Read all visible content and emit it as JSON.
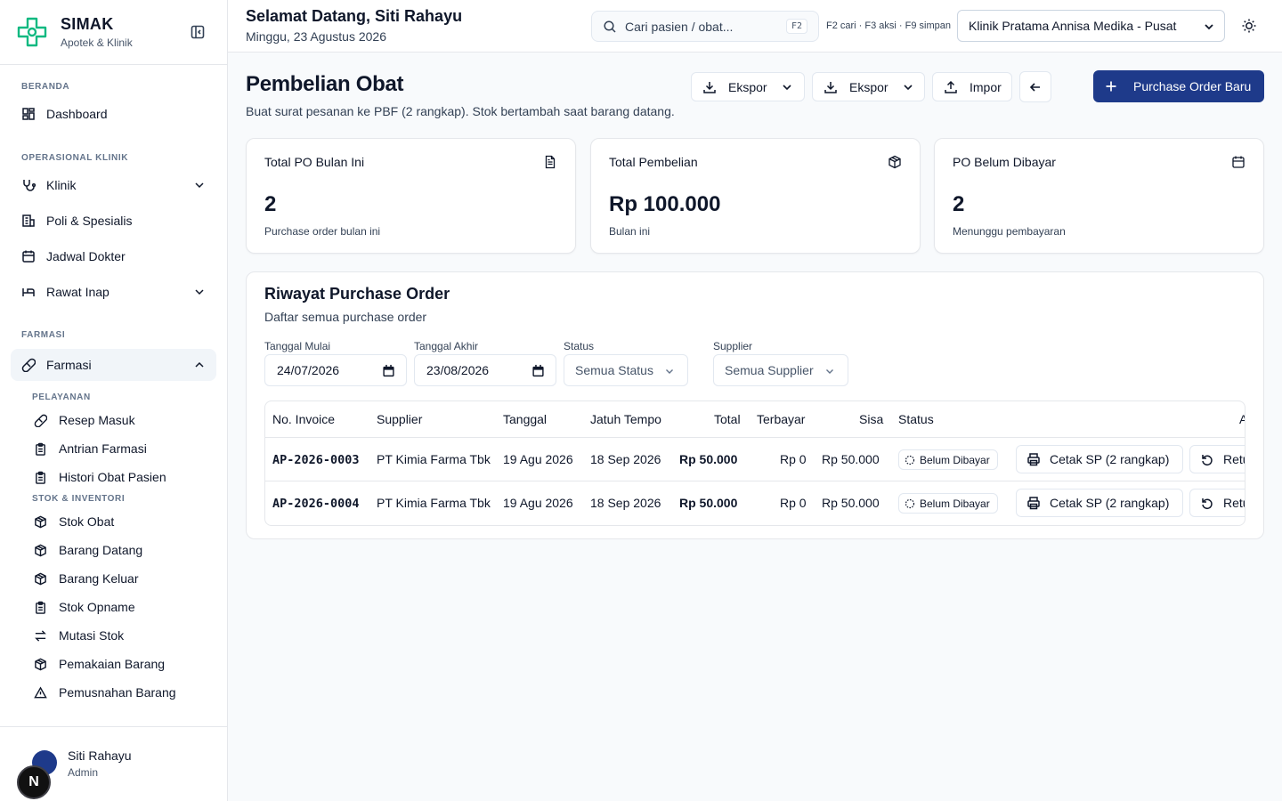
{
  "app": {
    "name": "SIMAK",
    "subtitle": "Apotek & Klinik"
  },
  "sidebar": {
    "sections": [
      {
        "label": "BERANDA"
      },
      {
        "label": "OPERASIONAL KLINIK"
      },
      {
        "label": "FARMASI"
      }
    ],
    "items": {
      "dashboard": "Dashboard",
      "klinik": "Klinik",
      "poli": "Poli & Spesialis",
      "jadwal": "Jadwal Dokter",
      "rawat_inap": "Rawat Inap",
      "farmasi": "Farmasi"
    },
    "sub_sections": {
      "pelayanan": "PELAYANAN",
      "stok": "STOK & INVENTORI"
    },
    "sub_items": {
      "resep": "Resep Masuk",
      "antrian": "Antrian Farmasi",
      "histori": "Histori Obat Pasien",
      "stok_obat": "Stok Obat",
      "barang_datang": "Barang Datang",
      "barang_keluar": "Barang Keluar",
      "stok_opname": "Stok Opname",
      "mutasi": "Mutasi Stok",
      "pemakaian": "Pemakaian Barang",
      "pemusnahan": "Pemusnahan Barang"
    }
  },
  "user": {
    "name": "Siti Rahayu",
    "role": "Admin",
    "badge_letter": "N"
  },
  "header": {
    "greeting": "Selamat Datang, Siti Rahayu",
    "date": "Minggu, 23 Agustus 2026",
    "search_placeholder": "Cari pasien / obat...",
    "search_shortcut": "F2",
    "shortcuts": "F2 cari · F3 aksi · F9 simpan",
    "clinic": "Klinik Pratama Annisa Medika - Pusat"
  },
  "page": {
    "title": "Pembelian Obat",
    "subtitle": "Buat surat pesanan ke PBF (2 rangkap). Stok bertambah saat barang datang.",
    "export1": "Ekspor",
    "export2": "Ekspor",
    "import": "Impor",
    "new_po": "Purchase Order Baru"
  },
  "stats": [
    {
      "title": "Total PO Bulan Ini",
      "value": "2",
      "note": "Purchase order bulan ini",
      "icon": "document-icon"
    },
    {
      "title": "Total Pembelian",
      "value": "Rp 100.000",
      "note": "Bulan ini",
      "icon": "box-icon"
    },
    {
      "title": "PO Belum Dibayar",
      "value": "2",
      "note": "Menunggu pembayaran",
      "icon": "calendar-icon"
    }
  ],
  "history": {
    "title": "Riwayat Purchase Order",
    "subtitle": "Daftar semua purchase order",
    "filters": {
      "start_label": "Tanggal Mulai",
      "start_value": "24/07/2026",
      "end_label": "Tanggal Akhir",
      "end_value": "23/08/2026",
      "status_label": "Status",
      "status_value": "Semua Status",
      "supplier_label": "Supplier",
      "supplier_value": "Semua Supplier"
    },
    "columns": [
      "No. Invoice",
      "Supplier",
      "Tanggal",
      "Jatuh Tempo",
      "Total",
      "Terbayar",
      "Sisa",
      "Status",
      "A"
    ],
    "rows": [
      {
        "invoice": "AP-2026-0003",
        "supplier": "PT Kimia Farma Tbk",
        "date": "19 Agu 2026",
        "due": "18 Sep 2026",
        "total": "Rp 50.000",
        "paid": "Rp 0",
        "remaining": "Rp 50.000",
        "status": "Belum Dibayar",
        "print": "Cetak SP (2 rangkap)",
        "retur": "Retur"
      },
      {
        "invoice": "AP-2026-0004",
        "supplier": "PT Kimia Farma Tbk",
        "date": "19 Agu 2026",
        "due": "18 Sep 2026",
        "total": "Rp 50.000",
        "paid": "Rp 0",
        "remaining": "Rp 50.000",
        "status": "Belum Dibayar",
        "print": "Cetak SP (2 rangkap)",
        "retur": "Retur"
      }
    ]
  },
  "colors": {
    "primary": "#1e3a8a",
    "brand_teal": "#10b981",
    "border": "#e5e7eb"
  }
}
